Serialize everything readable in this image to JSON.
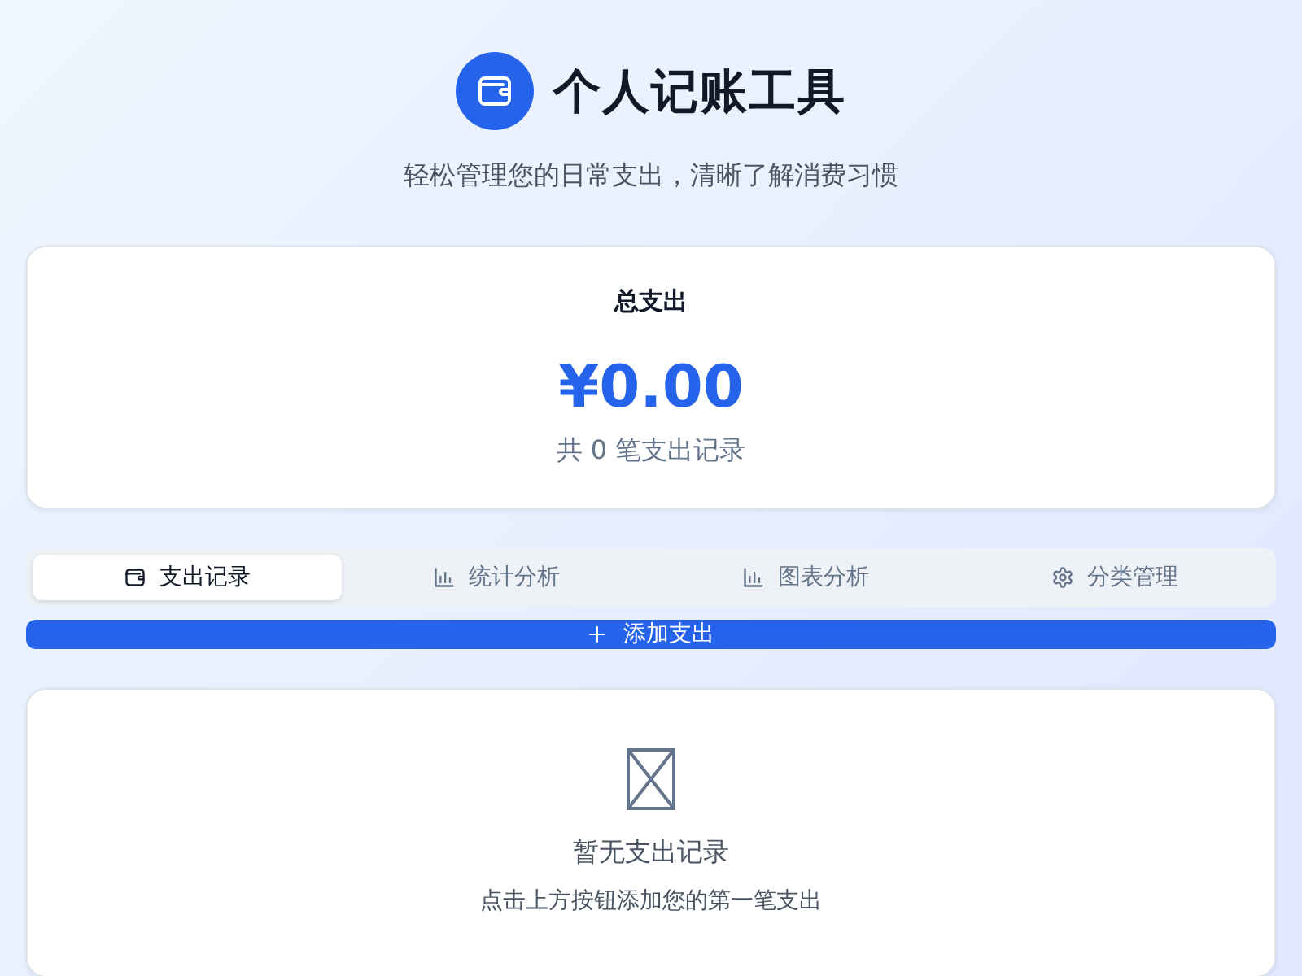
{
  "header": {
    "title": "个人记账工具",
    "subtitle": "轻松管理您的日常支出，清晰了解消费习惯"
  },
  "summary": {
    "label": "总支出",
    "amount": "¥0.00",
    "count_text": "共 0 笔支出记录"
  },
  "tabs": [
    {
      "label": "支出记录",
      "selected": true
    },
    {
      "label": "统计分析",
      "selected": false
    },
    {
      "label": "图表分析",
      "selected": false
    },
    {
      "label": "分类管理",
      "selected": false
    }
  ],
  "add_button": {
    "label": "添加支出"
  },
  "empty_state": {
    "title": "暂无支出记录",
    "hint": "点击上方按钮添加您的第一笔支出"
  }
}
